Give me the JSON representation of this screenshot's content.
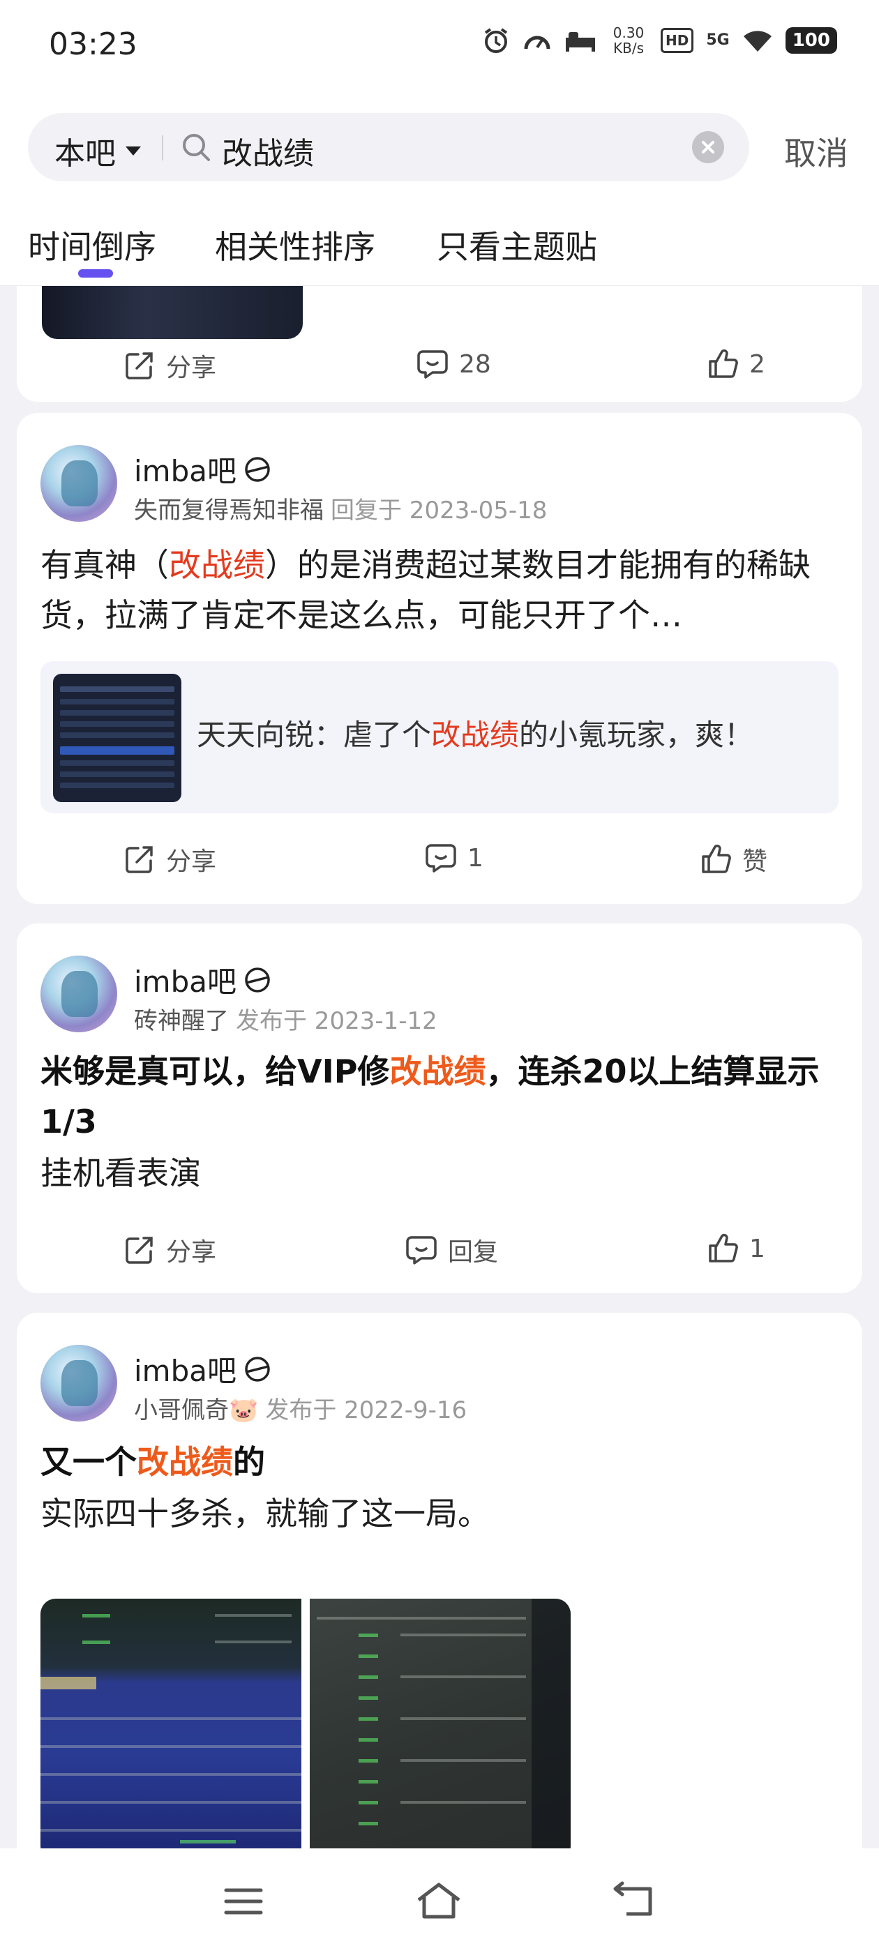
{
  "status_bar": {
    "time": "03:23",
    "net_speed_value": "0.30",
    "net_speed_unit": "KB/s",
    "hd": "HD",
    "signal": "5G",
    "battery": "100"
  },
  "search": {
    "scope": "本吧",
    "query": "改战绩",
    "cancel": "取消"
  },
  "tabs": [
    {
      "label": "时间倒序",
      "active": true
    },
    {
      "label": "相关性排序",
      "active": false
    },
    {
      "label": "只看主题贴",
      "active": false
    }
  ],
  "posts": [
    {
      "actions": {
        "share": "分享",
        "comment": "28",
        "like": "2"
      }
    },
    {
      "forum": "imba吧",
      "author": "失而复得焉知非福",
      "time": "回复于 2023-05-18",
      "body_before": "有真神（",
      "body_highlight": "改战绩",
      "body_after": "）的是消费超过某数目才能拥有的稀缺货，拉满了肯定不是这么点，可能只开了个…",
      "quote": {
        "before": "天天向锐：虐了个",
        "highlight": "改战绩",
        "after": "的小氪玩家，爽！"
      },
      "actions": {
        "share": "分享",
        "comment": "1",
        "like": "赞"
      }
    },
    {
      "forum": "imba吧",
      "author": "砖神醒了",
      "time": "发布于 2023-1-12",
      "title_before": "米够是真可以，给VIP修",
      "title_highlight": "改战绩",
      "title_after": "，连杀20以上结算显示1/3",
      "body": "挂机看表演",
      "actions": {
        "share": "分享",
        "comment": "回复",
        "like": "1"
      }
    },
    {
      "forum": "imba吧",
      "author": "小哥佩奇🐷",
      "time": "发布于 2022-9-16",
      "title_before": "又一个",
      "title_highlight": "改战绩",
      "title_after": "的",
      "body": "实际四十多杀，就输了这一局。"
    }
  ],
  "colors": {
    "accent": "#6451f0",
    "highlight": "#e33b1f",
    "background": "#f2f2f6"
  }
}
